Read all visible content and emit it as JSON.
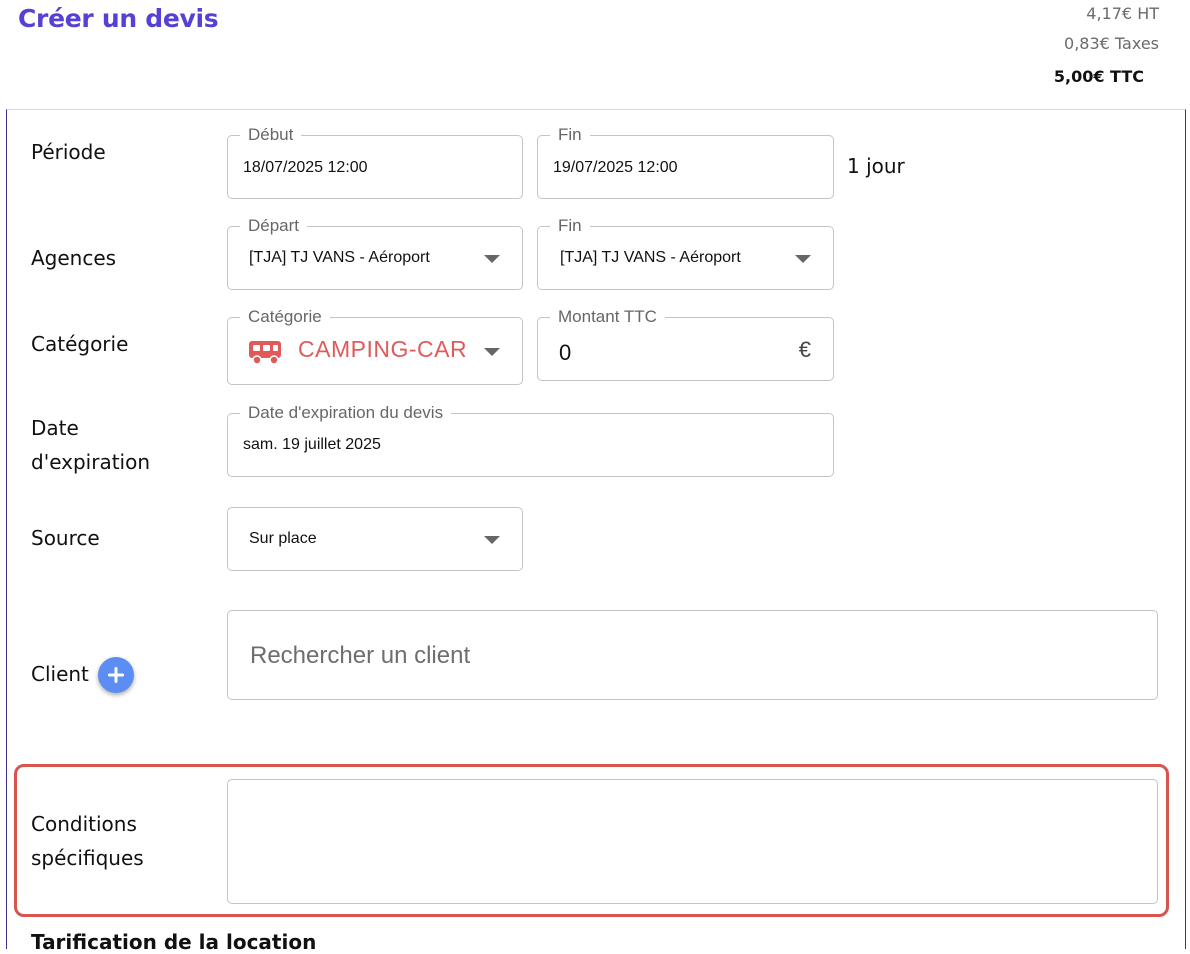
{
  "header": {
    "title": "Créer un devis",
    "total_ht": "4,17€ HT",
    "total_taxes": "0,83€ Taxes",
    "total_ttc": "5,00€ TTC"
  },
  "periode": {
    "label": "Période",
    "debut_legend": "Début",
    "debut_value": "18/07/2025 12:00",
    "fin_legend": "Fin",
    "fin_value": "19/07/2025 12:00",
    "duration": "1 jour"
  },
  "agences": {
    "label": "Agences",
    "depart_legend": "Départ",
    "depart_value": "[TJA] TJ VANS - Aéroport",
    "fin_legend": "Fin",
    "fin_value": "[TJA] TJ VANS - Aéroport"
  },
  "categorie": {
    "label": "Catégorie",
    "legend": "Catégorie",
    "value": "CAMPING-CAR",
    "icon": "camper-van-icon",
    "color": "#e15a5a",
    "montant_legend": "Montant TTC",
    "montant_value": "0",
    "currency": "€"
  },
  "expiration": {
    "label_line1": "Date",
    "label_line2": "d'expiration",
    "legend": "Date d'expiration du devis",
    "value": "sam. 19 juillet 2025"
  },
  "source": {
    "label": "Source",
    "value": "Sur place"
  },
  "client": {
    "label": "Client",
    "placeholder": "Rechercher un client",
    "add_icon": "plus-icon"
  },
  "conditions": {
    "label_line1": "Conditions",
    "label_line2": "spécifiques",
    "value": ""
  },
  "next_section": {
    "title": "Tarification de la location"
  },
  "colors": {
    "accent": "#5541d3",
    "highlight": "#d9534f",
    "add_button": "#5b8df3"
  }
}
